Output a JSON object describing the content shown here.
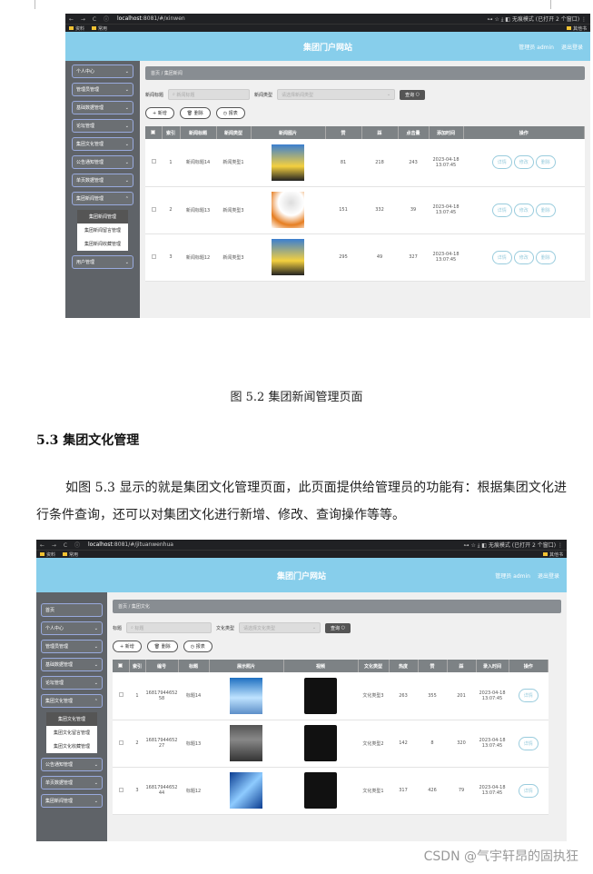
{
  "doc": {
    "caption_1": "图 5.2  集团新闻管理页面",
    "heading": "5.3 集团文化管理",
    "paragraph": "如图 5.3 显示的就是集团文化管理页面，此页面提供给管理员的功能有：根据集团文化进行条件查询，还可以对集团文化进行新增、修改、查询操作等等。",
    "watermark": "CSDN @气宇轩昂的固执狂"
  },
  "shot1": {
    "browser": {
      "nav": "← → C ⓘ",
      "url_host": "localhost",
      "url_rest": ":8081/#/xinwen",
      "right": "⊶ ☆ ⤓ ◧ 无痕模式 (已打开 2 个窗口) ⋮"
    },
    "bookmarks": [
      "资料",
      "常用"
    ],
    "bookmarks_right": "其他书",
    "header": {
      "title": "集团门户网站",
      "user": "管理员 admin",
      "logout": "退出登录"
    },
    "sidebar": [
      "个人中心",
      "管理员管理",
      "基础数据管理",
      "论坛管理",
      "集团文化管理",
      "公告通知管理",
      "单页数据管理",
      "集团新闻管理"
    ],
    "submenu": [
      "集团新闻管理",
      "集团新闻留言管理",
      "集团新闻收藏管理"
    ],
    "sidebar_last": "用户管理",
    "crumb": "首页 / 集团新闻",
    "filters": {
      "label1": "新闻标题",
      "ph1": "新闻标题",
      "label2": "新闻类型",
      "ph2": "请选择新闻类型",
      "query": "查询"
    },
    "actions": [
      "+ 新增",
      "删除",
      "报表"
    ],
    "columns": [
      "",
      "索引",
      "新闻标题",
      "新闻类型",
      "新闻图片",
      "赞",
      "踩",
      "点击量",
      "添加时间",
      "操作"
    ],
    "rows": [
      {
        "idx": "1",
        "title": "新闻标题14",
        "type": "新闻类型1",
        "zan": "81",
        "cai": "218",
        "hits": "243",
        "time": "2023-04-18 13:07:45"
      },
      {
        "idx": "2",
        "title": "新闻标题13",
        "type": "新闻类型3",
        "zan": "151",
        "cai": "332",
        "hits": "39",
        "time": "2023-04-18 13:07:45"
      },
      {
        "idx": "3",
        "title": "新闻标题12",
        "type": "新闻类型3",
        "zan": "295",
        "cai": "49",
        "hits": "327",
        "time": "2023-04-18 13:07:45"
      }
    ],
    "ops": [
      "详情",
      "修改",
      "删除"
    ]
  },
  "shot2": {
    "browser": {
      "nav": "← → C ⓘ",
      "url_host": "localhost",
      "url_rest": ":8081/#/jituanwenhua",
      "right": "⊶ ☆ ⤓ ◧ 无痕模式 (已打开 2 个窗口) ⋮"
    },
    "bookmarks": [
      "资料",
      "常用"
    ],
    "bookmarks_right": "其他书",
    "header": {
      "title": "集团门户网站",
      "user": "管理员 admin",
      "logout": "退出登录"
    },
    "sidebar": [
      "首页",
      "个人中心",
      "管理员管理",
      "基础数据管理",
      "论坛管理",
      "集团文化管理"
    ],
    "submenu": [
      "集团文化管理",
      "集团文化留言管理",
      "集团文化收藏管理"
    ],
    "sidebar_after": [
      "公告通知管理",
      "单页数据管理",
      "集团新闻管理"
    ],
    "crumb": "首页 / 集团文化",
    "filters": {
      "label1": "标题",
      "ph1": "标题",
      "label2": "文化类型",
      "ph2": "请选择文化类型",
      "query": "查询"
    },
    "actions": [
      "+ 新增",
      "删除",
      "报表"
    ],
    "columns": [
      "",
      "索引",
      "编号",
      "标题",
      "展示照片",
      "视频",
      "文化类型",
      "热度",
      "赞",
      "踩",
      "录入时间",
      "操作"
    ],
    "rows": [
      {
        "idx": "1",
        "num": "1681794465258",
        "title": "标题14",
        "type": "文化类型3",
        "heat": "263",
        "zan": "355",
        "cai": "201",
        "time": "2023-04-18 13:07:45"
      },
      {
        "idx": "2",
        "num": "1681794465227",
        "title": "标题13",
        "type": "文化类型2",
        "heat": "142",
        "zan": "8",
        "cai": "320",
        "time": "2023-04-18 13:07:45"
      },
      {
        "idx": "3",
        "num": "1681794465244",
        "title": "标题12",
        "type": "文化类型1",
        "heat": "317",
        "zan": "426",
        "cai": "79",
        "time": "2023-04-18 13:07:45"
      }
    ],
    "op": "详情"
  }
}
